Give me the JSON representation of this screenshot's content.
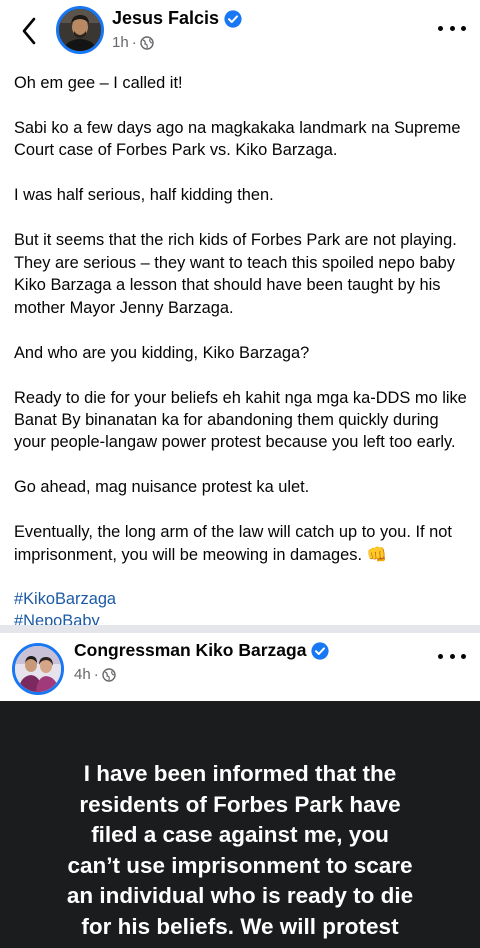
{
  "post": {
    "author": "Jesus Falcis",
    "time": "1h",
    "paragraphs": [
      "Oh em gee – I called it!",
      "Sabi ko a few days ago na magkakaka landmark na Supreme Court case of Forbes Park vs. Kiko Barzaga.",
      "I was half serious, half kidding then.",
      "But it seems that the rich kids of Forbes Park are not playing. They are serious – they want to teach this spoiled nepo baby Kiko Barzaga a lesson that should have been taught by his mother Mayor Jenny Barzaga.",
      "And who are you kidding, Kiko Barzaga?",
      "Ready to die for your beliefs eh kahit nga mga ka-DDS mo like Banat By binanatan ka for abandoning them quickly during your people-langaw power protest because you left too early.",
      "Go ahead, mag nuisance protest ka ulet.",
      "Eventually, the long arm of the law will catch up to you. If not imprisonment, you will be meowing in damages. 👊"
    ],
    "hashtags": [
      "#KikoBarzaga",
      "#NepoBaby"
    ]
  },
  "shared": {
    "author": "Congressman Kiko Barzaga",
    "time": "4h",
    "quote_lines": [
      "I have been informed that the",
      "residents of Forbes Park have",
      "filed a case against me, you",
      "can’t use imprisonment to scare",
      "an individual who is ready to die",
      "for his beliefs. We will protest"
    ]
  },
  "colors": {
    "verified": "#1877f2",
    "hashtag": "#1b5aa6",
    "quote_bg": "#1b1c1e"
  },
  "icons": [
    "back-chevron-icon",
    "verified-badge-icon",
    "globe-icon",
    "more-options-icon"
  ]
}
